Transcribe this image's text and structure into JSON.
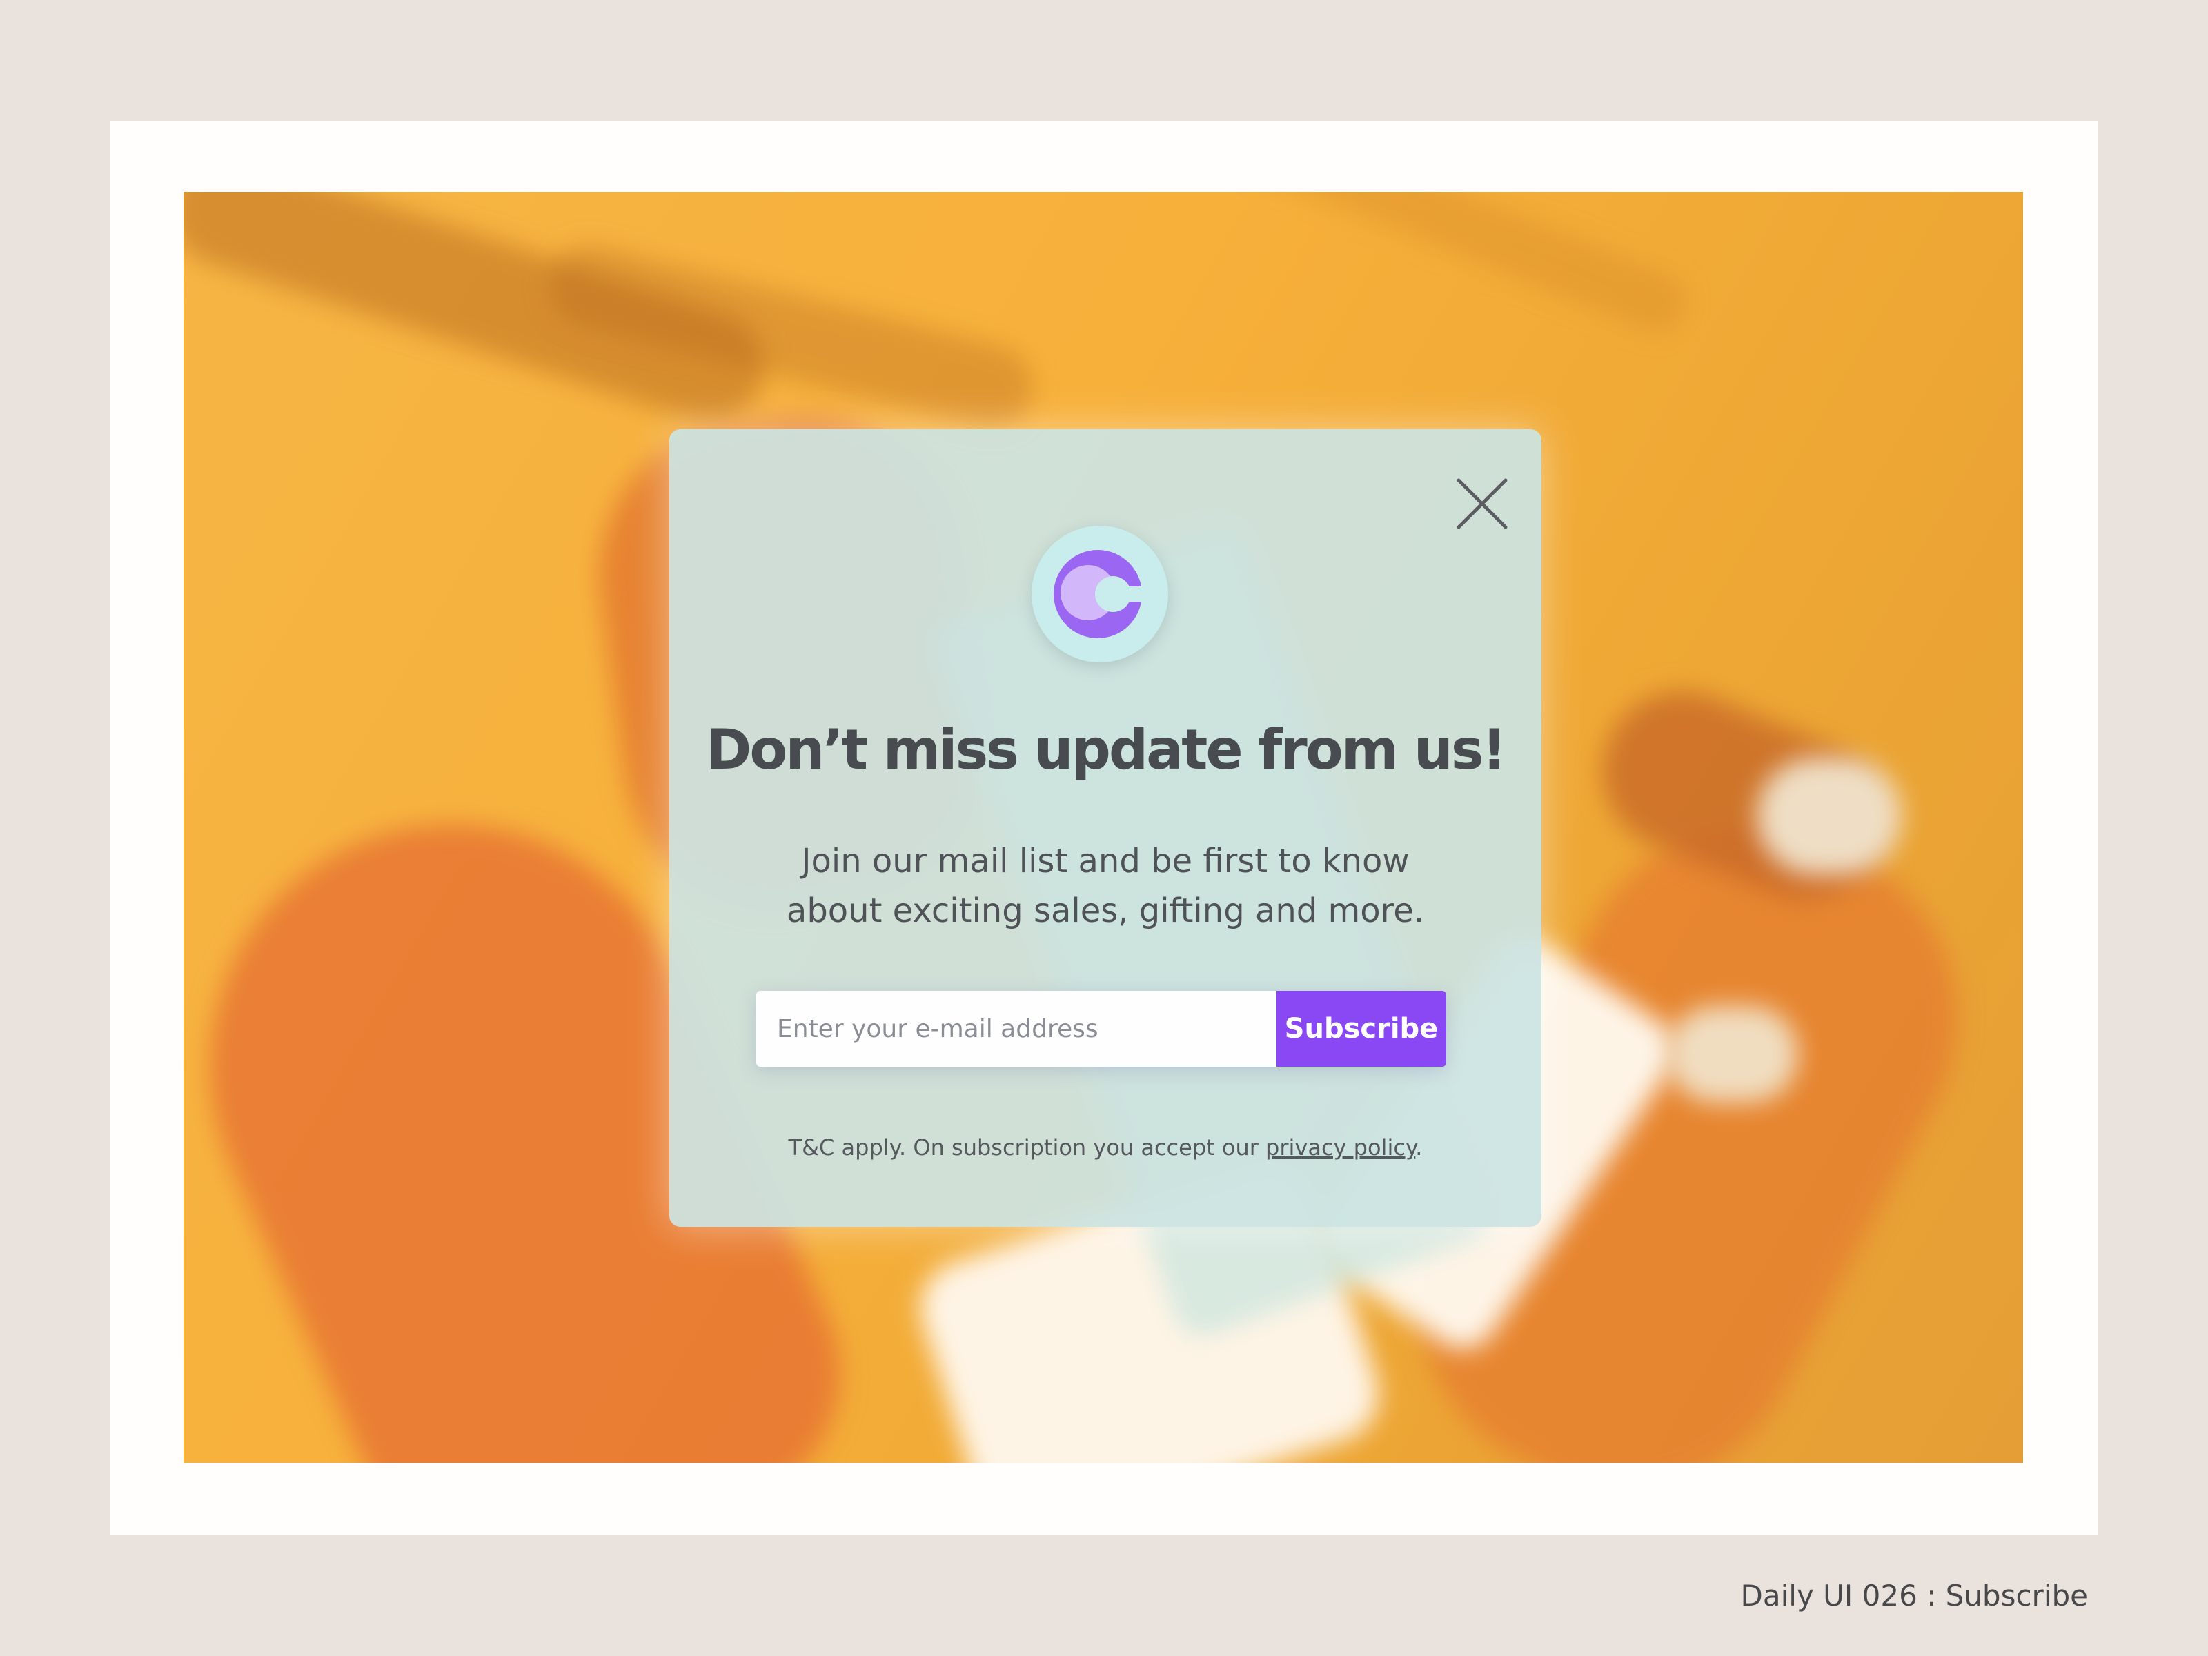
{
  "modal": {
    "title": "Don’t miss update from us!",
    "subtitle_line1": "Join our mail list and be first to know",
    "subtitle_line2": "about exciting sales, gifting and more.",
    "email_placeholder": "Enter your e-mail address",
    "subscribe_label": "Subscribe",
    "terms_prefix": "T&C apply. On subscription you accept our ",
    "privacy_link": "privacy policy",
    "terms_suffix": ".",
    "close_icon": "close-icon",
    "logo_icon": "c-logo-icon",
    "accent_color": "#8948f4"
  },
  "caption": "Daily UI 026 :  Subscribe"
}
